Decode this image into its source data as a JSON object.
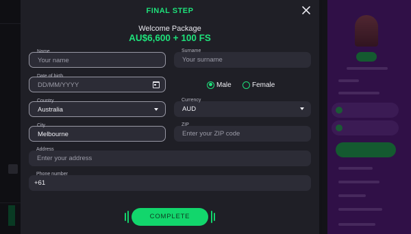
{
  "modal": {
    "title": "FINAL STEP",
    "welcome": "Welcome Package",
    "bonus": "AU$6,600 + 100 FS"
  },
  "form": {
    "name": {
      "label": "Name",
      "placeholder": "Your name"
    },
    "surname": {
      "label": "Surname",
      "placeholder": "Your surname"
    },
    "dob": {
      "label": "Date of birth",
      "placeholder": "DD/MM/YYYY"
    },
    "gender": {
      "male": "Male",
      "female": "Female",
      "selected": "male"
    },
    "country": {
      "label": "Country",
      "value": "Australia"
    },
    "currency": {
      "label": "Currency",
      "value": "AUD"
    },
    "city": {
      "label": "City",
      "value": "Melbourne"
    },
    "zip": {
      "label": "ZIP",
      "placeholder": "Enter your ZIP code"
    },
    "address": {
      "label": "Address",
      "placeholder": "Enter your address"
    },
    "phone": {
      "label": "Phone number",
      "value": "+61"
    },
    "submit": "COMPLETE"
  },
  "colors": {
    "accent": "#1ee27b",
    "button": "#12d66c",
    "field": "#2c2c36",
    "modal": "#1f1f26",
    "sidebar_purple": "#4a1a6e"
  },
  "icons": {
    "close": "close-icon",
    "calendar": "calendar-icon",
    "dropdown": "chevron-down-icon"
  }
}
